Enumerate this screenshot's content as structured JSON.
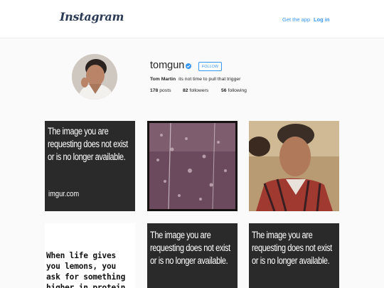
{
  "header": {
    "logo": "Instagram",
    "get_app_label": "Get the app",
    "login_label": "Log in"
  },
  "profile": {
    "username": "tomgun",
    "follow_label": "FOLLOW",
    "full_name": "Tom Martin",
    "bio": "its not time to pull that trigger",
    "stats": [
      {
        "count": "178",
        "label": "posts"
      },
      {
        "count": "82",
        "label": "followers"
      },
      {
        "count": "56",
        "label": "following"
      }
    ]
  },
  "posts": {
    "error_lines": [
      "The image you are",
      "requesting does not exist",
      "or is no longer available."
    ],
    "error_url": "imgur.com",
    "quote_lines": [
      "When life gives",
      "you lemons, you",
      "ask for something",
      "higher in protein."
    ]
  },
  "colors": {
    "accent": "#3897f0",
    "tile_dark": "#2a2a2a",
    "background": "#fafafa"
  },
  "icons": {
    "verified": "verified-badge-icon"
  }
}
